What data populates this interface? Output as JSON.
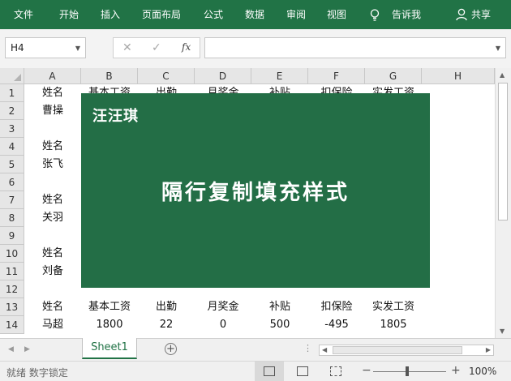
{
  "ribbon": {
    "tabs": [
      "文件",
      "开始",
      "插入",
      "页面布局",
      "公式",
      "数据",
      "审阅",
      "视图"
    ],
    "tell_me": "告诉我",
    "share": "共享",
    "tell_icon": "lightbulb-icon",
    "share_icon": "person-icon",
    "color": "#217346"
  },
  "formula_bar": {
    "name_box": "H4",
    "cancel_icon": "✕",
    "enter_icon": "✓",
    "fx": "fx",
    "value": ""
  },
  "grid": {
    "columns": [
      "A",
      "B",
      "C",
      "D",
      "E",
      "F",
      "G",
      "H"
    ],
    "rows": [
      "1",
      "2",
      "3",
      "4",
      "5",
      "6",
      "7",
      "8",
      "9",
      "10",
      "11",
      "12",
      "13",
      "14"
    ],
    "cells": [
      [
        "姓名",
        "基本工资",
        "出勤",
        "月奖金",
        "补贴",
        "扣保险",
        "实发工资",
        ""
      ],
      [
        "曹操",
        "",
        "",
        "",
        "",
        "",
        "",
        ""
      ],
      [
        "",
        "",
        "",
        "",
        "",
        "",
        "",
        ""
      ],
      [
        "姓名",
        "",
        "",
        "",
        "",
        "",
        "",
        ""
      ],
      [
        "张飞",
        "",
        "",
        "",
        "",
        "",
        "",
        ""
      ],
      [
        "",
        "",
        "",
        "",
        "",
        "",
        "",
        ""
      ],
      [
        "姓名",
        "",
        "",
        "",
        "",
        "",
        "",
        ""
      ],
      [
        "关羽",
        "",
        "",
        "",
        "",
        "",
        "",
        ""
      ],
      [
        "",
        "",
        "",
        "",
        "",
        "",
        "",
        ""
      ],
      [
        "姓名",
        "",
        "",
        "",
        "",
        "",
        "",
        ""
      ],
      [
        "刘备",
        "",
        "",
        "",
        "",
        "",
        "",
        ""
      ],
      [
        "",
        "",
        "",
        "",
        "",
        "",
        "",
        ""
      ],
      [
        "姓名",
        "基本工资",
        "出勤",
        "月奖金",
        "补贴",
        "扣保险",
        "实发工资",
        ""
      ],
      [
        "马超",
        "1800",
        "22",
        "0",
        "500",
        "-495",
        "1805",
        ""
      ]
    ]
  },
  "banner": {
    "brand": "汪汪琪",
    "title": "隔行复制填充样式",
    "color": "#236e46"
  },
  "sheets": {
    "active": "Sheet1",
    "add_icon": "plus-circle-icon"
  },
  "status": {
    "text": "就绪  数字锁定",
    "zoom": "100%"
  }
}
